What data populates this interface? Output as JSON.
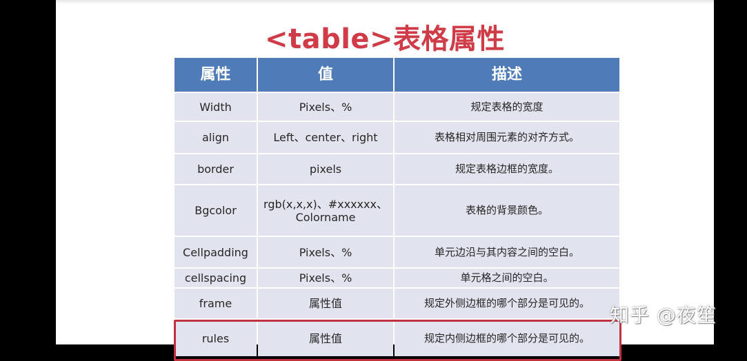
{
  "slide": {
    "title": "<table>表格属性"
  },
  "table": {
    "headers": [
      "属性",
      "值",
      "描述"
    ],
    "rows": [
      {
        "attr": "Width",
        "value": "Pixels、%",
        "desc": "规定表格的宽度"
      },
      {
        "attr": "align",
        "value": "Left、center、right",
        "desc": "表格相对周围元素的对齐方式。"
      },
      {
        "attr": "border",
        "value": "pixels",
        "desc": "规定表格边框的宽度。"
      },
      {
        "attr": "Bgcolor",
        "value_line1": "rgb(x,x,x)、#xxxxxx、",
        "value_line2": "Colorname",
        "desc": "表格的背景颜色。"
      },
      {
        "attr": "Cellpadding",
        "value": "Pixels、%",
        "desc": "单元边沿与其内容之间的空白。"
      },
      {
        "attr": "cellspacing",
        "value": "Pixels、%",
        "desc": "单元格之间的空白。"
      },
      {
        "attr": "frame",
        "value": "属性值",
        "desc": "规定外侧边框的哪个部分是可见的。"
      },
      {
        "attr": "rules",
        "value": "属性值",
        "desc": "规定内侧边框的哪个部分是可见的。"
      }
    ]
  },
  "watermark": "知乎 @夜笙",
  "colors": {
    "title": "#cf3b47",
    "header_bg": "#4f7cb6",
    "cell_bg": "#e1e4ee",
    "highlight_border": "#c0303f"
  }
}
